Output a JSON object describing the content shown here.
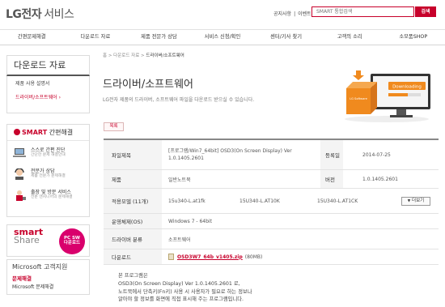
{
  "header": {
    "logo_brand": "LG전자",
    "logo_service": "서비스",
    "top_link_notice": "공지사항",
    "top_link_sep": "|",
    "top_link_event": "이벤트",
    "search_placeholder": "SMART 통합검색",
    "search_button": "검색"
  },
  "gnb": [
    "간편문제해결",
    "다운로드 자료",
    "제품 전문가 상담",
    "서비스 신청/확인",
    "센터/기사 찾기",
    "고객의 소리",
    "소모품SHOP"
  ],
  "sidebar": {
    "title": "다운로드 자료",
    "items": [
      {
        "label": "제품 사용 설명서",
        "active": false
      },
      {
        "label": "드라이버/소프트웨어",
        "active": true,
        "arrow": "›"
      }
    ],
    "smart": {
      "title_smart": "SMART",
      "title_rest": "간편해결",
      "rows": [
        {
          "title": "스스로 간편 진단",
          "sub": "간단한 문제 해결안내",
          "icon": "laptop-diagnosis-icon"
        },
        {
          "title": "전문가 상담",
          "sub": "제품 전문가 문제해결",
          "icon": "headset-agent-icon"
        },
        {
          "title": "출장 및 방문 서비스",
          "sub": "전문 엔지니어의 문제해결",
          "icon": "engineer-visit-icon"
        }
      ]
    },
    "banner_share": {
      "smart": "smart",
      "share": "Share",
      "circle_line1": "PC SW",
      "circle_line2": "다운로드"
    },
    "banner_ms": {
      "line1": "Microsoft 고객지원",
      "line2": "문제해결",
      "line3": "Microsoft 문제해결"
    }
  },
  "breadcrumb": {
    "home": "홈",
    "sep": ">",
    "level1": "다운로드 자료",
    "current": "드라이버/소프트웨어"
  },
  "page": {
    "title": "드라이버/소프트웨어",
    "description": "LG전자 제품의 드라이버, 소프트웨어 파일을 다운로드 받으실 수 있습니다.",
    "hero_label": "Downloading",
    "hero_box_label": "LG Software",
    "list_button": "목록"
  },
  "detail": {
    "file_title_label": "파일제목",
    "file_title": "[프로그램/Win7_64bit] OSD3(On Screen Display) Ver 1.0.1405.2601",
    "date_label": "등록일",
    "date": "2014-07-25",
    "product_label": "제품",
    "product": "일반노트북",
    "version_label": "버전",
    "version": "1.0.1405.2601",
    "models_label": "적용모델 (11개)",
    "models": [
      "15u340-L.at1fk",
      "15U340-L.AT10K",
      "15U340-L.AT1CK"
    ],
    "more_button": "더보기",
    "os_label": "운영체제(OS)",
    "os": "Windows 7 - 64bit",
    "category_label": "드라이버 분류",
    "category": "소프트웨어",
    "download_label": "다운로드",
    "file_name": "OSD3W7_64b_v1405.zip",
    "file_size": "(80MB)"
  },
  "description_body": {
    "line1": "본 프로그램은",
    "line2": "OSD3(On Screen Display) Ver 1.0.1405.2601 로,",
    "line3": "노트북에서 단축키(Fn키) 사용 시 사용자가 필요로 하는 정보나",
    "line4": "알아야 할 정보를 화면에 직접 표시해 주는 프로그램입니다."
  },
  "colors": {
    "accent": "#c7002b",
    "magenta": "#d9006c",
    "table_header_bg": "#f4f4f4",
    "hero_orange": "#f08a1e"
  }
}
